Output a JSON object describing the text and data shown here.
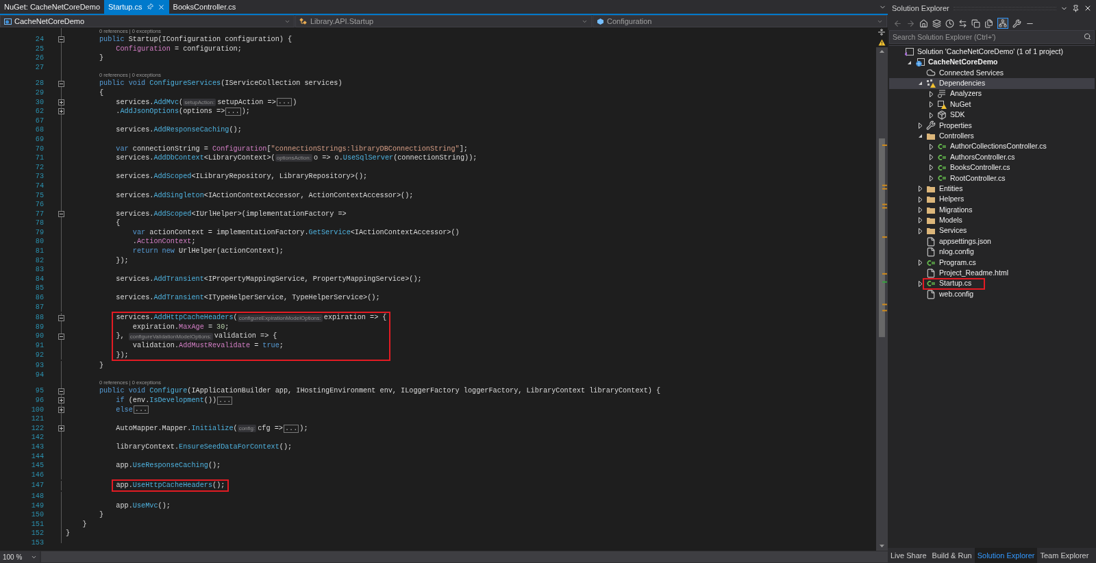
{
  "tabs": [
    {
      "label": "NuGet: CacheNetCoreDemo",
      "selected": false
    },
    {
      "label": "Startup.cs",
      "selected": true
    },
    {
      "label": "BooksController.cs",
      "selected": false
    }
  ],
  "navigation_bar": [
    {
      "kind": "project",
      "text": "CacheNetCoreDemo"
    },
    {
      "kind": "class",
      "text": "Library.API.Startup"
    },
    {
      "kind": "member",
      "text": "Configuration"
    }
  ],
  "code_lines": [
    {
      "kind": "lens",
      "text": "0 references | 0 exceptions"
    },
    {
      "kind": "code",
      "number": "24",
      "fold_toggle": true,
      "folded": false,
      "boxed": false,
      "tokens": [
        {
          "kind": "keyword",
          "text": "        public"
        },
        {
          "kind": "text",
          "text": " Startup(IConfiguration configuration) {"
        }
      ]
    },
    {
      "kind": "code",
      "number": "25",
      "fold_toggle": false,
      "boxed": false,
      "tokens": [
        {
          "kind": "property",
          "text": "            Configuration"
        },
        {
          "kind": "text",
          "text": " = configuration;"
        }
      ]
    },
    {
      "kind": "code",
      "number": "26",
      "fold_toggle": false,
      "boxed": false,
      "tokens": [
        {
          "kind": "text",
          "text": "        }"
        }
      ]
    },
    {
      "kind": "code",
      "number": "27",
      "fold_toggle": false,
      "boxed": false
    },
    {
      "kind": "lens",
      "text": "0 references | 0 exceptions"
    },
    {
      "kind": "code",
      "number": "28",
      "fold_toggle": true,
      "folded": false,
      "boxed": false,
      "tokens": [
        {
          "kind": "keyword",
          "text": "        public void"
        },
        {
          "kind": "method",
          "text": " ConfigureServices"
        },
        {
          "kind": "text",
          "text": "(IServiceCollection services)"
        }
      ]
    },
    {
      "kind": "code",
      "number": "29",
      "fold_toggle": false,
      "boxed": false,
      "tokens": [
        {
          "kind": "text",
          "text": "        {"
        }
      ]
    },
    {
      "kind": "code",
      "number": "30",
      "fold_toggle": true,
      "folded": true,
      "boxed": false,
      "tokens": [
        {
          "kind": "text",
          "text": "            services."
        },
        {
          "kind": "method",
          "text": "AddMvc"
        },
        {
          "kind": "text",
          "text": "("
        },
        {
          "kind": "hint",
          "text": "setupAction:"
        },
        {
          "kind": "text",
          "text": "setupAction =>"
        },
        {
          "kind": "collapsed",
          "text": "..."
        },
        {
          "kind": "text",
          "text": ")"
        }
      ]
    },
    {
      "kind": "code",
      "number": "62",
      "fold_toggle": true,
      "folded": true,
      "boxed": false,
      "tokens": [
        {
          "kind": "text",
          "text": "            ."
        },
        {
          "kind": "method",
          "text": "AddJsonOptions"
        },
        {
          "kind": "text",
          "text": "(options =>"
        },
        {
          "kind": "collapsed",
          "text": "..."
        },
        {
          "kind": "text",
          "text": ");"
        }
      ]
    },
    {
      "kind": "code",
      "number": "67",
      "fold_toggle": false,
      "boxed": false
    },
    {
      "kind": "code",
      "number": "68",
      "fold_toggle": false,
      "boxed": false,
      "tokens": [
        {
          "kind": "text",
          "text": "            services."
        },
        {
          "kind": "method",
          "text": "AddResponseCaching"
        },
        {
          "kind": "text",
          "text": "();"
        }
      ]
    },
    {
      "kind": "code",
      "number": "69",
      "fold_toggle": false,
      "boxed": false
    },
    {
      "kind": "code",
      "number": "70",
      "fold_toggle": false,
      "boxed": false,
      "tokens": [
        {
          "kind": "keyword",
          "text": "            var"
        },
        {
          "kind": "text",
          "text": " connectionString = "
        },
        {
          "kind": "property",
          "text": "Configuration"
        },
        {
          "kind": "text",
          "text": "["
        },
        {
          "kind": "string",
          "text": "\"connectionStrings:libraryDBConnectionString\""
        },
        {
          "kind": "text",
          "text": "];"
        }
      ]
    },
    {
      "kind": "code",
      "number": "71",
      "fold_toggle": false,
      "boxed": false,
      "tokens": [
        {
          "kind": "text",
          "text": "            services."
        },
        {
          "kind": "method",
          "text": "AddDbContext"
        },
        {
          "kind": "text",
          "text": "<LibraryContext>("
        },
        {
          "kind": "hint",
          "text": "optionsAction:"
        },
        {
          "kind": "text",
          "text": "o => o."
        },
        {
          "kind": "method",
          "text": "UseSqlServer"
        },
        {
          "kind": "text",
          "text": "(connectionString));"
        }
      ]
    },
    {
      "kind": "code",
      "number": "72",
      "fold_toggle": false,
      "boxed": false
    },
    {
      "kind": "code",
      "number": "73",
      "fold_toggle": false,
      "boxed": false,
      "tokens": [
        {
          "kind": "text",
          "text": "            services."
        },
        {
          "kind": "method",
          "text": "AddScoped"
        },
        {
          "kind": "text",
          "text": "<ILibraryRepository, LibraryRepository>();"
        }
      ]
    },
    {
      "kind": "code",
      "number": "74",
      "fold_toggle": false,
      "boxed": false
    },
    {
      "kind": "code",
      "number": "75",
      "fold_toggle": false,
      "boxed": false,
      "tokens": [
        {
          "kind": "text",
          "text": "            services."
        },
        {
          "kind": "method",
          "text": "AddSingleton"
        },
        {
          "kind": "text",
          "text": "<IActionContextAccessor, ActionContextAccessor>();"
        }
      ]
    },
    {
      "kind": "code",
      "number": "76",
      "fold_toggle": false,
      "boxed": false
    },
    {
      "kind": "code",
      "number": "77",
      "fold_toggle": true,
      "folded": false,
      "boxed": false,
      "tokens": [
        {
          "kind": "text",
          "text": "            services."
        },
        {
          "kind": "method",
          "text": "AddScoped"
        },
        {
          "kind": "text",
          "text": "<IUrlHelper>(implementationFactory =>"
        }
      ]
    },
    {
      "kind": "code",
      "number": "78",
      "fold_toggle": false,
      "boxed": false,
      "tokens": [
        {
          "kind": "text",
          "text": "            {"
        }
      ]
    },
    {
      "kind": "code",
      "number": "79",
      "fold_toggle": false,
      "boxed": false,
      "tokens": [
        {
          "kind": "keyword",
          "text": "                var"
        },
        {
          "kind": "text",
          "text": " actionContext = implementationFactory."
        },
        {
          "kind": "method",
          "text": "GetService"
        },
        {
          "kind": "text",
          "text": "<IActionContextAccessor>()"
        }
      ]
    },
    {
      "kind": "code",
      "number": "80",
      "fold_toggle": false,
      "boxed": false,
      "tokens": [
        {
          "kind": "text",
          "text": "                ."
        },
        {
          "kind": "property",
          "text": "ActionContext"
        },
        {
          "kind": "text",
          "text": ";"
        }
      ]
    },
    {
      "kind": "code",
      "number": "81",
      "fold_toggle": false,
      "boxed": false,
      "tokens": [
        {
          "kind": "keyword",
          "text": "                return new"
        },
        {
          "kind": "text",
          "text": " UrlHelper(actionContext);"
        }
      ]
    },
    {
      "kind": "code",
      "number": "82",
      "fold_toggle": false,
      "boxed": false,
      "tokens": [
        {
          "kind": "text",
          "text": "            });"
        }
      ]
    },
    {
      "kind": "code",
      "number": "83",
      "fold_toggle": false,
      "boxed": false
    },
    {
      "kind": "code",
      "number": "84",
      "fold_toggle": false,
      "boxed": false,
      "tokens": [
        {
          "kind": "text",
          "text": "            services."
        },
        {
          "kind": "method",
          "text": "AddTransient"
        },
        {
          "kind": "text",
          "text": "<IPropertyMappingService, PropertyMappingService>();"
        }
      ]
    },
    {
      "kind": "code",
      "number": "85",
      "fold_toggle": false,
      "boxed": false
    },
    {
      "kind": "code",
      "number": "86",
      "fold_toggle": false,
      "boxed": false,
      "tokens": [
        {
          "kind": "text",
          "text": "            services."
        },
        {
          "kind": "method",
          "text": "AddTransient"
        },
        {
          "kind": "text",
          "text": "<ITypeHelperService, TypeHelperService>();"
        }
      ]
    },
    {
      "kind": "code",
      "number": "87",
      "fold_toggle": false,
      "boxed": false
    },
    {
      "kind": "code",
      "number": "88",
      "fold_toggle": true,
      "folded": false,
      "boxed": true,
      "tokens": [
        {
          "kind": "text",
          "text": "            services."
        },
        {
          "kind": "method",
          "text": "AddHttpCacheHeaders"
        },
        {
          "kind": "text",
          "text": "("
        },
        {
          "kind": "hint",
          "text": "configureExpirationModelOptions:"
        },
        {
          "kind": "text",
          "text": "expiration => {"
        }
      ]
    },
    {
      "kind": "code",
      "number": "89",
      "fold_toggle": false,
      "boxed": true,
      "tokens": [
        {
          "kind": "text",
          "text": "                expiration."
        },
        {
          "kind": "property",
          "text": "MaxAge"
        },
        {
          "kind": "text",
          "text": " = "
        },
        {
          "kind": "number",
          "text": "30"
        },
        {
          "kind": "text",
          "text": ";"
        }
      ]
    },
    {
      "kind": "code",
      "number": "90",
      "fold_toggle": true,
      "folded": false,
      "boxed": true,
      "tokens": [
        {
          "kind": "text",
          "text": "            }, "
        },
        {
          "kind": "hint",
          "text": "configureValidationModelOptions:"
        },
        {
          "kind": "text",
          "text": "validation => {"
        }
      ]
    },
    {
      "kind": "code",
      "number": "91",
      "fold_toggle": false,
      "boxed": true,
      "tokens": [
        {
          "kind": "text",
          "text": "                validation."
        },
        {
          "kind": "property",
          "text": "AddMustRevalidate"
        },
        {
          "kind": "text",
          "text": " = "
        },
        {
          "kind": "keyword",
          "text": "true"
        },
        {
          "kind": "text",
          "text": ";"
        }
      ]
    },
    {
      "kind": "code",
      "number": "92",
      "fold_toggle": false,
      "boxed": true,
      "tokens": [
        {
          "kind": "text",
          "text": "            });"
        }
      ]
    },
    {
      "kind": "code",
      "number": "93",
      "fold_toggle": false,
      "boxed": false,
      "tokens": [
        {
          "kind": "text",
          "text": "        }"
        }
      ]
    },
    {
      "kind": "code",
      "number": "94",
      "fold_toggle": false,
      "boxed": false
    },
    {
      "kind": "lens",
      "text": "0 references | 0 exceptions"
    },
    {
      "kind": "code",
      "number": "95",
      "fold_toggle": true,
      "folded": false,
      "boxed": false,
      "tokens": [
        {
          "kind": "keyword",
          "text": "        public void"
        },
        {
          "kind": "method",
          "text": " Configure"
        },
        {
          "kind": "text",
          "text": "(IApplicationBuilder app, IHostingEnvironment env, ILoggerFactory loggerFactory, LibraryContext libraryContext) {"
        }
      ]
    },
    {
      "kind": "code",
      "number": "96",
      "fold_toggle": true,
      "folded": true,
      "boxed": false,
      "tokens": [
        {
          "kind": "keyword",
          "text": "            if"
        },
        {
          "kind": "text",
          "text": " (env."
        },
        {
          "kind": "method",
          "text": "IsDevelopment"
        },
        {
          "kind": "text",
          "text": "())"
        },
        {
          "kind": "collapsed",
          "text": "..."
        }
      ]
    },
    {
      "kind": "code",
      "number": "100",
      "fold_toggle": true,
      "folded": true,
      "boxed": false,
      "tokens": [
        {
          "kind": "keyword",
          "text": "            else"
        },
        {
          "kind": "collapsed",
          "text": "..."
        }
      ]
    },
    {
      "kind": "code",
      "number": "121",
      "fold_toggle": false,
      "boxed": false
    },
    {
      "kind": "code",
      "number": "122",
      "fold_toggle": true,
      "folded": true,
      "boxed": false,
      "tokens": [
        {
          "kind": "text",
          "text": "            AutoMapper.Mapper."
        },
        {
          "kind": "method",
          "text": "Initialize"
        },
        {
          "kind": "text",
          "text": "("
        },
        {
          "kind": "hint",
          "text": "config:"
        },
        {
          "kind": "text",
          "text": "cfg =>"
        },
        {
          "kind": "collapsed",
          "text": "..."
        },
        {
          "kind": "text",
          "text": ");"
        }
      ]
    },
    {
      "kind": "code",
      "number": "142",
      "fold_toggle": false,
      "boxed": false
    },
    {
      "kind": "code",
      "number": "143",
      "fold_toggle": false,
      "boxed": false,
      "tokens": [
        {
          "kind": "text",
          "text": "            libraryContext."
        },
        {
          "kind": "method",
          "text": "EnsureSeedDataForContext"
        },
        {
          "kind": "text",
          "text": "();"
        }
      ]
    },
    {
      "kind": "code",
      "number": "144",
      "fold_toggle": false,
      "boxed": false
    },
    {
      "kind": "code",
      "number": "145",
      "fold_toggle": false,
      "boxed": false,
      "tokens": [
        {
          "kind": "text",
          "text": "            app."
        },
        {
          "kind": "method",
          "text": "UseResponseCaching"
        },
        {
          "kind": "text",
          "text": "();"
        }
      ]
    },
    {
      "kind": "code",
      "number": "146",
      "fold_toggle": false,
      "boxed": false
    },
    {
      "kind": "code",
      "number": "147",
      "fold_toggle": false,
      "boxed": true,
      "tokens": [
        {
          "kind": "text",
          "text": "            app."
        },
        {
          "kind": "method",
          "text": "UseHttpCacheHeaders"
        },
        {
          "kind": "text",
          "text": "();"
        }
      ]
    },
    {
      "kind": "code",
      "number": "148",
      "fold_toggle": false,
      "boxed": false
    },
    {
      "kind": "code",
      "number": "149",
      "fold_toggle": false,
      "boxed": false,
      "tokens": [
        {
          "kind": "text",
          "text": "            app."
        },
        {
          "kind": "method",
          "text": "UseMvc"
        },
        {
          "kind": "text",
          "text": "();"
        }
      ]
    },
    {
      "kind": "code",
      "number": "150",
      "fold_toggle": false,
      "boxed": false,
      "tokens": [
        {
          "kind": "text",
          "text": "        }"
        }
      ]
    },
    {
      "kind": "code",
      "number": "151",
      "fold_toggle": false,
      "boxed": false,
      "tokens": [
        {
          "kind": "text",
          "text": "    }"
        }
      ]
    },
    {
      "kind": "code",
      "number": "152",
      "fold_toggle": false,
      "boxed": false,
      "tokens": [
        {
          "kind": "text",
          "text": "}"
        }
      ]
    },
    {
      "kind": "code",
      "number": "153",
      "fold_toggle": false,
      "boxed": false
    }
  ],
  "zoom": "100 %",
  "solution_explorer": {
    "title": "Solution Explorer",
    "tree_view_toggle_on": true,
    "search": {
      "placeholder": "Search Solution Explorer (Ctrl+')"
    },
    "tree": [
      {
        "kind": "solution",
        "label": "Solution 'CacheNetCoreDemo' (1 of 1 project)",
        "expandable": false,
        "selected": false,
        "boxed": false,
        "children": [
          {
            "kind": "project",
            "label": "CacheNetCoreDemo",
            "expandable": true,
            "expanded": true,
            "selected": false,
            "boxed": false,
            "children": [
              {
                "kind": "connected",
                "label": "Connected Services",
                "expandable": false,
                "selected": false,
                "boxed": false
              },
              {
                "kind": "dependencies",
                "label": "Dependencies",
                "expandable": true,
                "expanded": true,
                "selected": true,
                "boxed": false,
                "children": [
                  {
                    "kind": "analyzers",
                    "label": "Analyzers",
                    "expandable": true,
                    "expanded": false,
                    "selected": false,
                    "boxed": false
                  },
                  {
                    "kind": "nuget",
                    "label": "NuGet",
                    "expandable": true,
                    "expanded": false,
                    "selected": false,
                    "boxed": false
                  },
                  {
                    "kind": "sdk",
                    "label": "SDK",
                    "expandable": true,
                    "expanded": false,
                    "selected": false,
                    "boxed": false
                  }
                ]
              },
              {
                "kind": "properties",
                "label": "Properties",
                "expandable": true,
                "expanded": false,
                "selected": false,
                "boxed": false
              },
              {
                "kind": "folder",
                "label": "Controllers",
                "expandable": true,
                "expanded": true,
                "selected": false,
                "boxed": false,
                "children": [
                  {
                    "kind": "csharp",
                    "label": "AuthorCollectionsController.cs",
                    "expandable": true,
                    "expanded": false,
                    "selected": false,
                    "boxed": false
                  },
                  {
                    "kind": "csharp",
                    "label": "AuthorsController.cs",
                    "expandable": true,
                    "expanded": false,
                    "selected": false,
                    "boxed": false
                  },
                  {
                    "kind": "csharp",
                    "label": "BooksController.cs",
                    "expandable": true,
                    "expanded": false,
                    "selected": false,
                    "boxed": false
                  },
                  {
                    "kind": "csharp",
                    "label": "RootController.cs",
                    "expandable": true,
                    "expanded": false,
                    "selected": false,
                    "boxed": false
                  }
                ]
              },
              {
                "kind": "folder",
                "label": "Entities",
                "expandable": true,
                "expanded": false,
                "selected": false,
                "boxed": false
              },
              {
                "kind": "folder",
                "label": "Helpers",
                "expandable": true,
                "expanded": false,
                "selected": false,
                "boxed": false
              },
              {
                "kind": "folder",
                "label": "Migrations",
                "expandable": true,
                "expanded": false,
                "selected": false,
                "boxed": false
              },
              {
                "kind": "folder",
                "label": "Models",
                "expandable": true,
                "expanded": false,
                "selected": false,
                "boxed": false
              },
              {
                "kind": "folder",
                "label": "Services",
                "expandable": true,
                "expanded": false,
                "selected": false,
                "boxed": false
              },
              {
                "kind": "json",
                "label": "appsettings.json",
                "expandable": false,
                "selected": false,
                "boxed": false
              },
              {
                "kind": "config",
                "label": "nlog.config",
                "expandable": false,
                "selected": false,
                "boxed": false
              },
              {
                "kind": "csharp",
                "label": "Program.cs",
                "expandable": true,
                "expanded": false,
                "selected": false,
                "boxed": false
              },
              {
                "kind": "html",
                "label": "Project_Readme.html",
                "expandable": false,
                "selected": false,
                "boxed": false
              },
              {
                "kind": "csharp",
                "label": "Startup.cs",
                "expandable": true,
                "expanded": false,
                "selected": false,
                "boxed": true
              },
              {
                "kind": "config",
                "label": "web.config",
                "expandable": false,
                "selected": false,
                "boxed": false
              }
            ]
          }
        ]
      }
    ],
    "bottom_tabs": [
      {
        "label": "Live Share",
        "selected": false
      },
      {
        "label": "Build & Run",
        "selected": false
      },
      {
        "label": "Solution Explorer",
        "selected": true
      },
      {
        "label": "Team Explorer",
        "selected": false
      }
    ]
  }
}
